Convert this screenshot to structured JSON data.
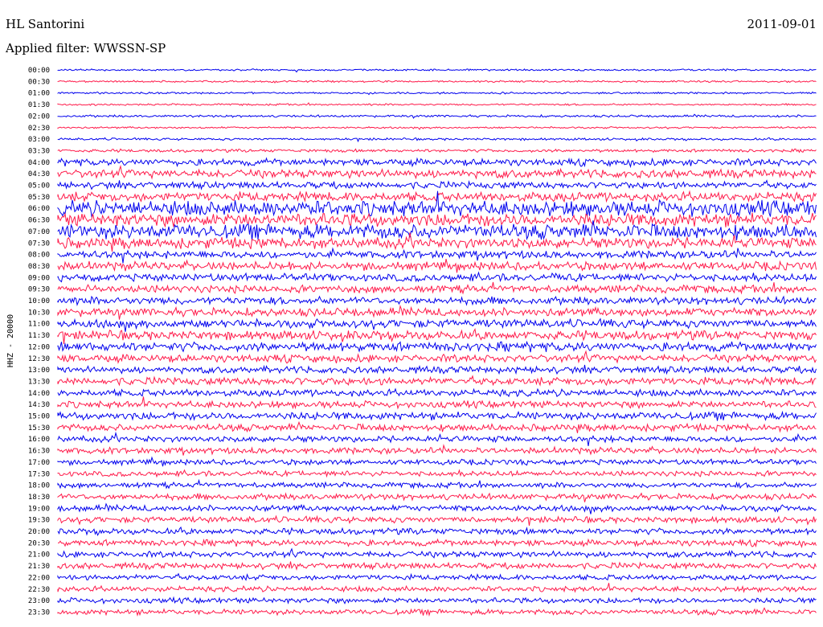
{
  "header": {
    "station": "HL Santorini",
    "date": "2011-09-01",
    "filter_label": "Applied filter: WWSSN-SP"
  },
  "chart_data": {
    "type": "line",
    "title": "HL Santorini",
    "ylabel": "HHZ - 20000",
    "trace_colors": [
      "#0000ee",
      "#ff1a4a"
    ],
    "hour_labels": [
      "00:00",
      "00:30",
      "01:00",
      "01:30",
      "02:00",
      "02:30",
      "03:00",
      "03:30",
      "04:00",
      "04:30",
      "05:00",
      "05:30",
      "06:00",
      "06:30",
      "07:00",
      "07:30",
      "08:00",
      "08:30",
      "09:00",
      "09:30",
      "10:00",
      "10:30",
      "11:00",
      "11:30",
      "12:00",
      "12:30",
      "13:00",
      "13:30",
      "14:00",
      "14:30",
      "15:00",
      "15:30",
      "16:00",
      "16:30",
      "17:00",
      "17:30",
      "18:00",
      "18:30",
      "19:00",
      "19:30",
      "20:00",
      "20:30",
      "21:00",
      "21:30",
      "22:00",
      "22:30",
      "23:00",
      "23:30"
    ],
    "row_amplitude": [
      0.12,
      0.12,
      0.12,
      0.12,
      0.15,
      0.12,
      0.15,
      0.2,
      0.45,
      0.55,
      0.45,
      0.6,
      1.0,
      0.85,
      0.95,
      0.7,
      0.5,
      0.55,
      0.5,
      0.5,
      0.5,
      0.55,
      0.55,
      0.6,
      0.6,
      0.5,
      0.45,
      0.5,
      0.45,
      0.45,
      0.5,
      0.45,
      0.4,
      0.4,
      0.35,
      0.35,
      0.35,
      0.4,
      0.4,
      0.4,
      0.4,
      0.4,
      0.4,
      0.4,
      0.35,
      0.35,
      0.35,
      0.35
    ]
  }
}
